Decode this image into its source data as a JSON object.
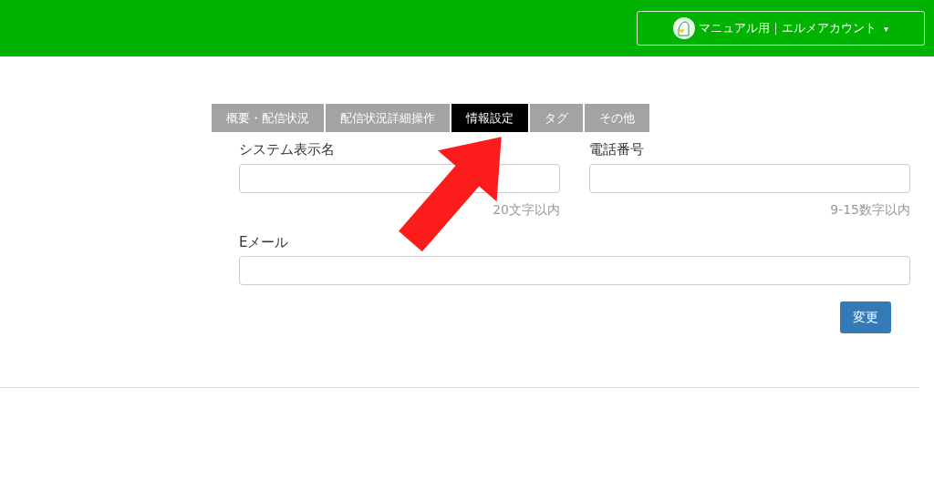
{
  "header": {
    "account": {
      "label": "マニュアル用｜エルメアカウント",
      "caret": "▾"
    }
  },
  "tabs": [
    {
      "label": "概要・配信状況",
      "selected": false
    },
    {
      "label": "配信状況詳細操作",
      "selected": false
    },
    {
      "label": "情報設定",
      "selected": true
    },
    {
      "label": "タグ",
      "selected": false
    },
    {
      "label": "その他",
      "selected": false
    }
  ],
  "form": {
    "fields": [
      {
        "label": "システム表示名",
        "hint": "20文字以内"
      },
      {
        "label": "電話番号",
        "hint": "9-15数字以内"
      },
      {
        "label": "Eメール"
      }
    ],
    "submit": "変更"
  }
}
